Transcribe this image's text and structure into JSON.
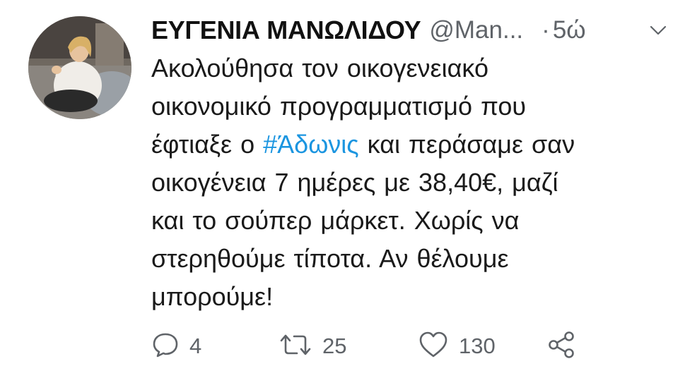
{
  "author": {
    "name": "ΕΥΓΕΝΙΑ ΜΑΝΩΛΙΔΟΥ",
    "handle": "@Man...",
    "separator": "·",
    "time": "5ώ"
  },
  "body": {
    "line1": "Ακολούθησα τον οικογενειακό",
    "line2": "οικονομικό προγραμματισμό που",
    "line3_pre": "έφτιαξε ο ",
    "hashtag": "#Άδωνις",
    "line3_post": " και περάσαμε σαν",
    "line4": "οικογένεια 7 ημέρες με 38,40€, μαζί",
    "line5": "και το σούπερ μάρκετ. Χωρίς να",
    "line6": "στερηθούμε τίποτα. Αν θέλουμε",
    "line7": "μπορούμε!"
  },
  "actions": {
    "reply_count": "4",
    "retweet_count": "25",
    "like_count": "130"
  },
  "icons": {
    "reply": "speech-bubble-icon",
    "retweet": "retweet-icon",
    "like": "heart-icon",
    "share": "share-icon",
    "menu": "chevron-down-icon"
  },
  "colors": {
    "hashtag": "#1b95e0",
    "secondary_text": "#5f6368",
    "icon": "#5f6368"
  }
}
